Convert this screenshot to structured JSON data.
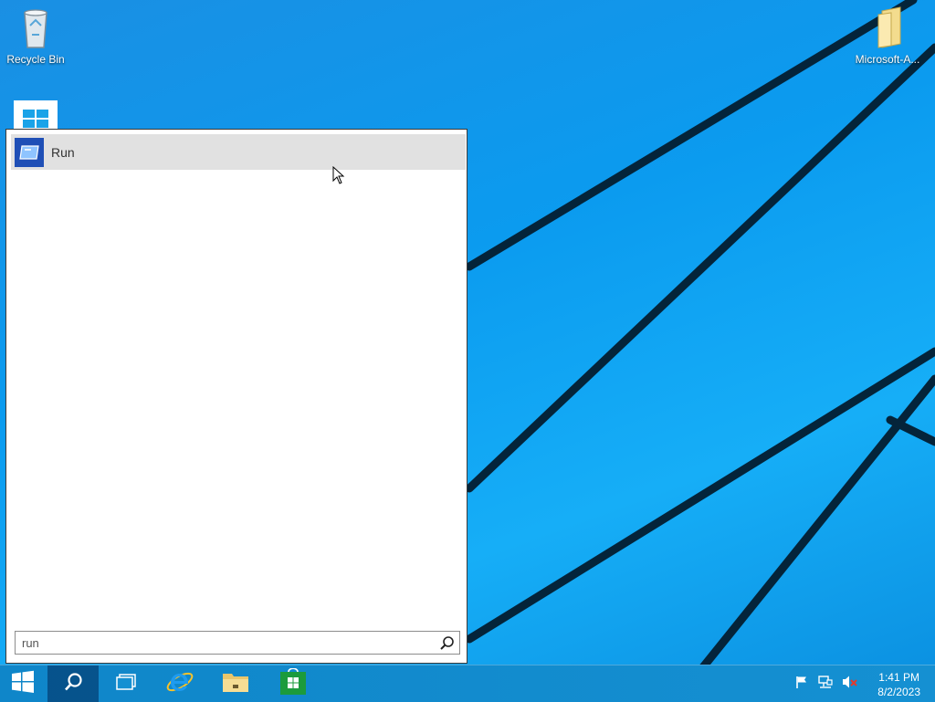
{
  "desktop": {
    "icons": [
      {
        "label": "Recycle Bin",
        "icon": "recycle-bin-icon"
      },
      {
        "label": "Microsoft-A...",
        "icon": "folder-icon"
      },
      {
        "label": "",
        "icon": "windows-tile-icon"
      }
    ]
  },
  "search_panel": {
    "results": [
      {
        "label": "Run",
        "icon": "run-app-icon"
      }
    ],
    "query": "run",
    "search_icon": "search-icon"
  },
  "taskbar": {
    "buttons": [
      {
        "name": "start",
        "icon": "windows-logo-icon"
      },
      {
        "name": "search",
        "icon": "search-icon"
      },
      {
        "name": "task-view",
        "icon": "task-view-icon"
      },
      {
        "name": "internet-explorer",
        "icon": "internet-explorer-icon"
      },
      {
        "name": "file-explorer",
        "icon": "file-explorer-icon"
      },
      {
        "name": "store",
        "icon": "store-icon"
      }
    ],
    "tray": {
      "icons": [
        "action-center-flag-icon",
        "network-icon",
        "volume-muted-icon"
      ],
      "time": "1:41 PM",
      "date": "8/2/2023"
    }
  },
  "colors": {
    "wallpaper": "#0b9bef",
    "taskbar": "#1590d2",
    "selected_result": "#e1e1e1",
    "run_icon": "#1f4fb6"
  }
}
